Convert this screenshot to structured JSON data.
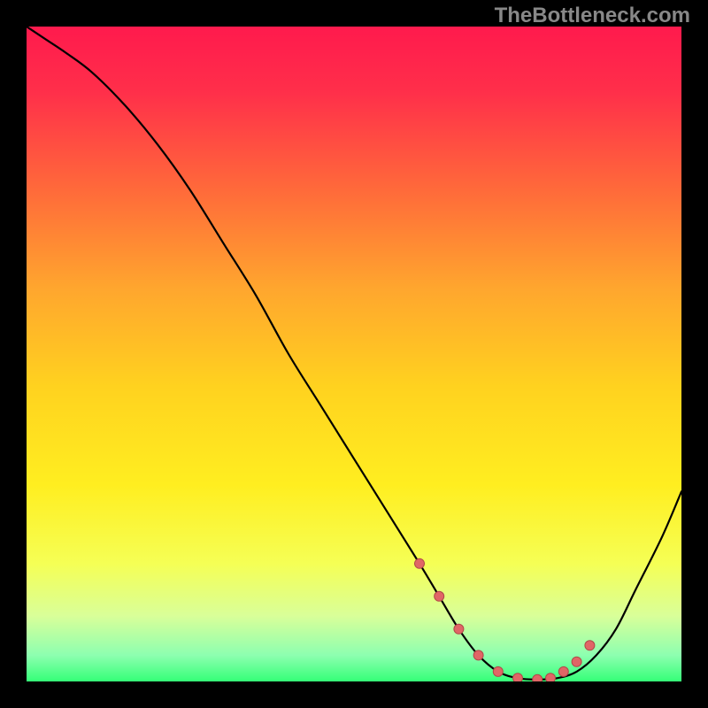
{
  "watermark": "TheBottleneck.com",
  "colors": {
    "page_bg": "#000000",
    "gradient_stops": [
      {
        "offset": 0.0,
        "color": "#ff1a4d"
      },
      {
        "offset": 0.1,
        "color": "#ff2f4a"
      },
      {
        "offset": 0.25,
        "color": "#ff6a3a"
      },
      {
        "offset": 0.4,
        "color": "#ffa62e"
      },
      {
        "offset": 0.55,
        "color": "#ffd21f"
      },
      {
        "offset": 0.7,
        "color": "#ffee20"
      },
      {
        "offset": 0.82,
        "color": "#f5ff55"
      },
      {
        "offset": 0.9,
        "color": "#d9ff99"
      },
      {
        "offset": 0.96,
        "color": "#8dffb0"
      },
      {
        "offset": 1.0,
        "color": "#34ff77"
      }
    ],
    "curve_stroke": "#000000",
    "marker_fill": "#e06666",
    "marker_stroke": "#b04848"
  },
  "chart_data": {
    "type": "line",
    "title": "",
    "xlabel": "",
    "ylabel": "",
    "xlim": [
      0,
      100
    ],
    "ylim": [
      0,
      100
    ],
    "series": [
      {
        "name": "bottleneck-curve",
        "x": [
          0,
          3,
          6,
          10,
          15,
          20,
          25,
          30,
          35,
          40,
          45,
          50,
          55,
          60,
          63,
          66,
          69,
          72,
          75,
          78,
          81,
          84,
          87,
          90,
          93,
          97,
          100
        ],
        "y": [
          100,
          98,
          96,
          93,
          88,
          82,
          75,
          67,
          59,
          50,
          42,
          34,
          26,
          18,
          13,
          8,
          4,
          1.5,
          0.5,
          0.3,
          0.5,
          1.5,
          4,
          8,
          14,
          22,
          29
        ]
      }
    ],
    "markers": {
      "name": "highlight-dots",
      "x": [
        60,
        63,
        66,
        69,
        72,
        75,
        78,
        80,
        82,
        84,
        86
      ],
      "y": [
        18,
        13,
        8,
        4,
        1.5,
        0.5,
        0.3,
        0.5,
        1.5,
        3,
        5.5
      ]
    }
  }
}
